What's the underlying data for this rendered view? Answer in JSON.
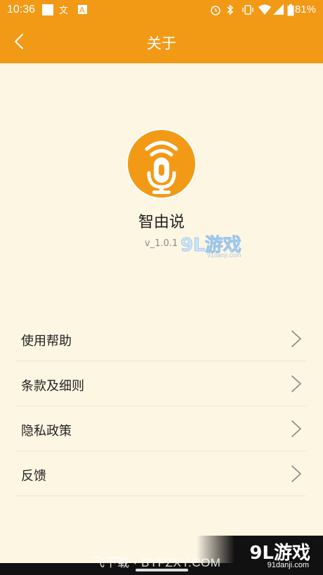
{
  "status_bar": {
    "time": "10:36",
    "battery": "81%",
    "icons": [
      "square-notification-icon",
      "translate-icon",
      "a-icon",
      "alarm-icon",
      "bluetooth-icon",
      "vibrate-icon",
      "wifi-icon",
      "signal-icon",
      "battery-icon"
    ]
  },
  "app_bar": {
    "title": "关于",
    "back_icon": "chevron-left-icon"
  },
  "about": {
    "app_name": "智由说",
    "version": "v_1.0.1",
    "logo_icon": "microphone-icon"
  },
  "menu": {
    "items": [
      {
        "label": "使用帮助",
        "icon": "chevron-right-icon"
      },
      {
        "label": "条款及细则",
        "icon": "chevron-right-icon"
      },
      {
        "label": "隐私政策",
        "icon": "chevron-right-icon"
      },
      {
        "label": "反馈",
        "icon": "chevron-right-icon"
      }
    ]
  },
  "watermark": {
    "center_brand": "9L游戏",
    "center_site": "91danji.com",
    "bottom_site": "飞下载 · BYFZXY.COM",
    "bottom_brand": "9L游戏",
    "bottom_sub": "91danji.com"
  },
  "colors": {
    "accent": "#f29a16",
    "background": "#fdf6e3"
  }
}
